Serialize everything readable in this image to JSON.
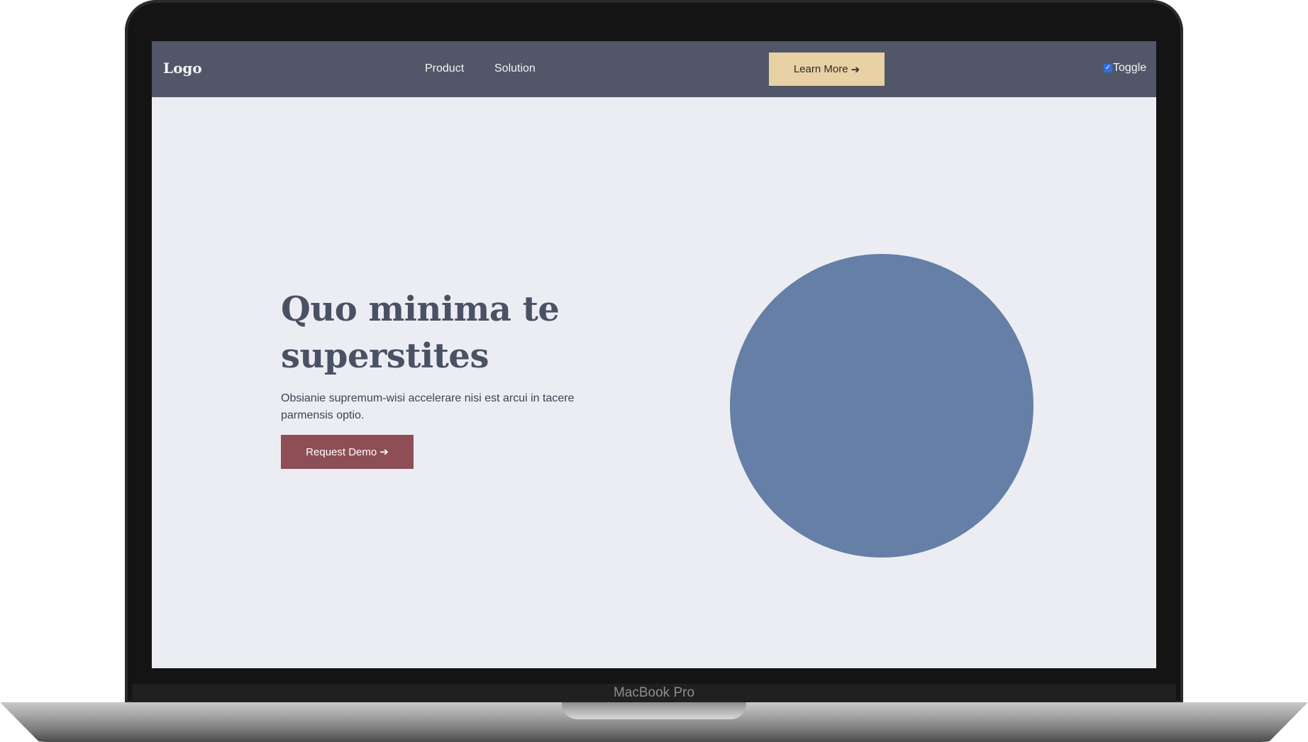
{
  "device": {
    "label": "MacBook Pro"
  },
  "navbar": {
    "logo": "Logo",
    "links": [
      {
        "label": "Product"
      },
      {
        "label": "Solution"
      }
    ],
    "cta_label": "Learn More",
    "cta_icon": "arrow-right-icon",
    "toggle": {
      "label": "Toggle",
      "checked": true
    }
  },
  "hero": {
    "title": "Quo minima te superstites",
    "description": "Obsianie supremum-wisi accelerare nisi est arcui in tacere parmensis optio.",
    "button_label": "Request Demo",
    "button_icon": "arrow-right-icon"
  },
  "colors": {
    "navbar_bg": "#515769",
    "page_bg": "#ecedf2",
    "cta_bg": "#e8d1a4",
    "demo_button_bg": "#8e4e55",
    "circle": "#657fa7",
    "title_text": "#4b5165"
  }
}
